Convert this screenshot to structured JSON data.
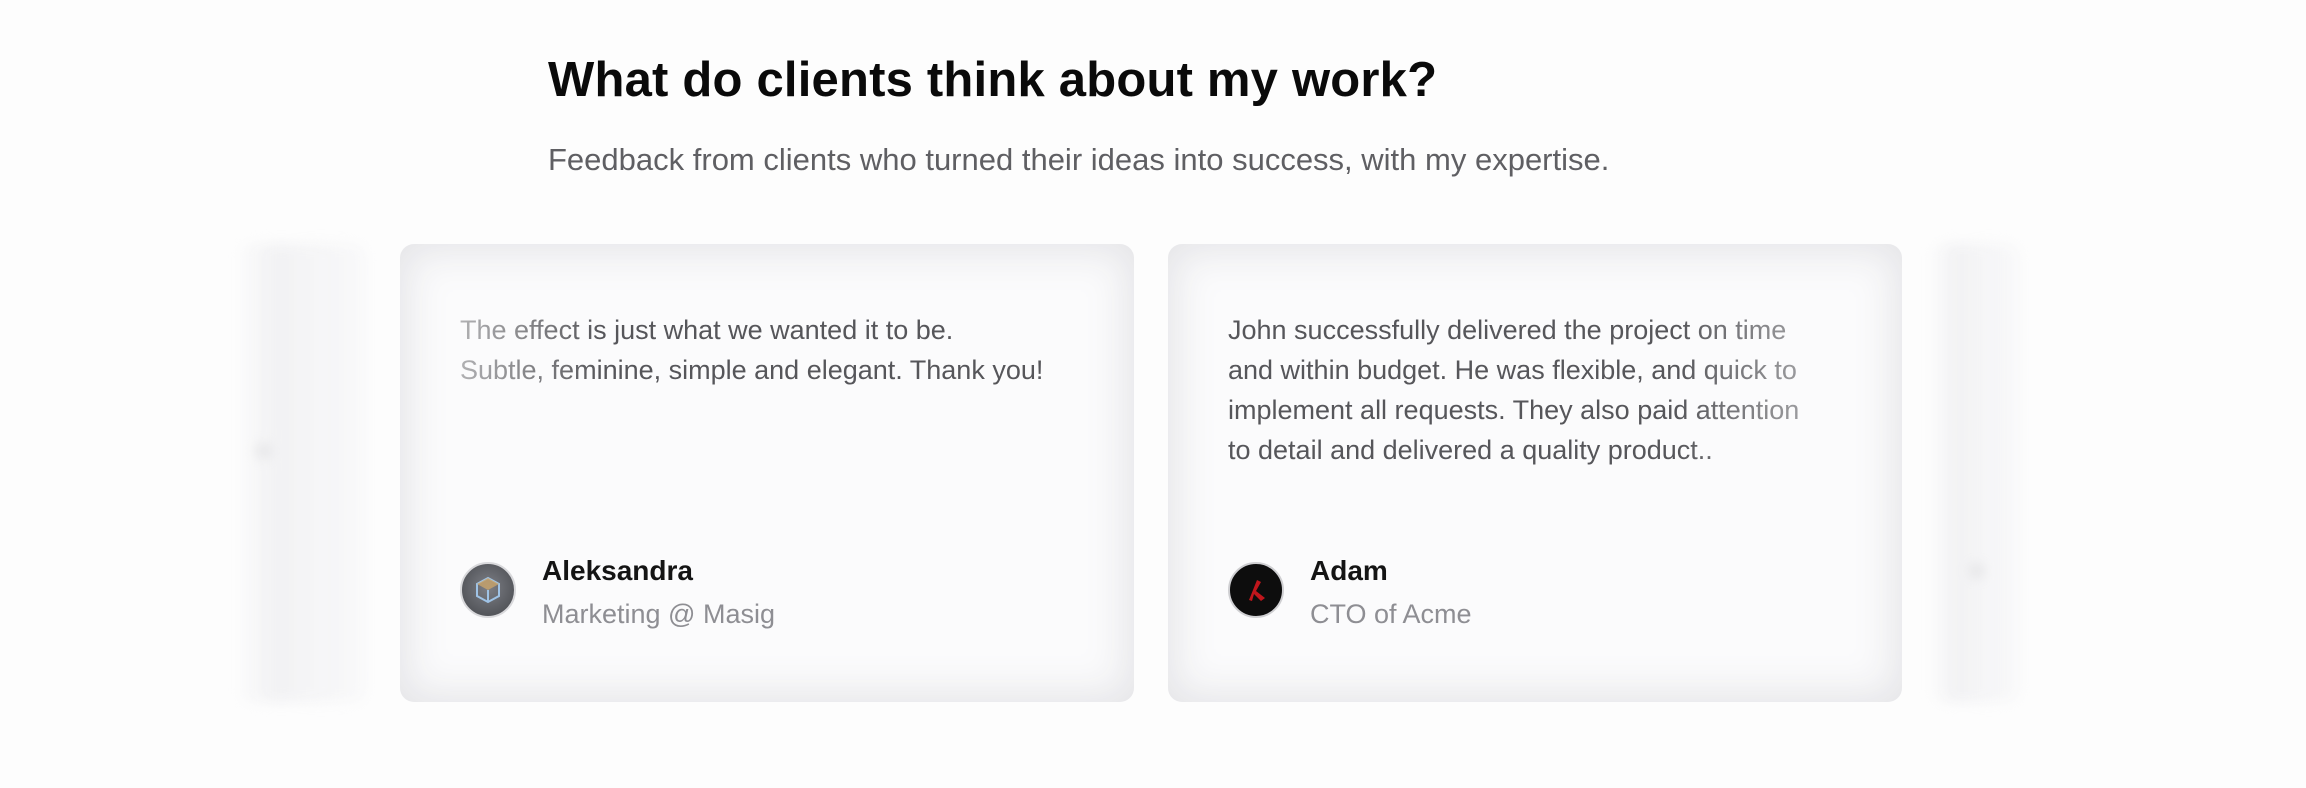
{
  "section": {
    "title": "What do clients think about my work?",
    "subtitle": "Feedback from clients who turned their ideas into success, with my expertise."
  },
  "testimonials": [
    {
      "quote": "The effect is just what we wanted it to be.\nSubtle, feminine, simple and elegant. Thank you!",
      "name": "Aleksandra",
      "role": "Marketing @ Masig",
      "avatar_icon": "masig-logo-icon"
    },
    {
      "quote": "John successfully delivered the project on time\nand within budget. He was flexible, and quick to\nimplement all requests. They also paid attention\nto detail and delivered a quality product..",
      "name": "Adam",
      "role": "CTO of Acme",
      "avatar_icon": "acme-logo-icon"
    }
  ],
  "colors": {
    "title": "#0a0a0a",
    "subtitle": "#5f5f63",
    "card_bg": "#fbfbfc",
    "acme_accent": "#c0161c"
  }
}
